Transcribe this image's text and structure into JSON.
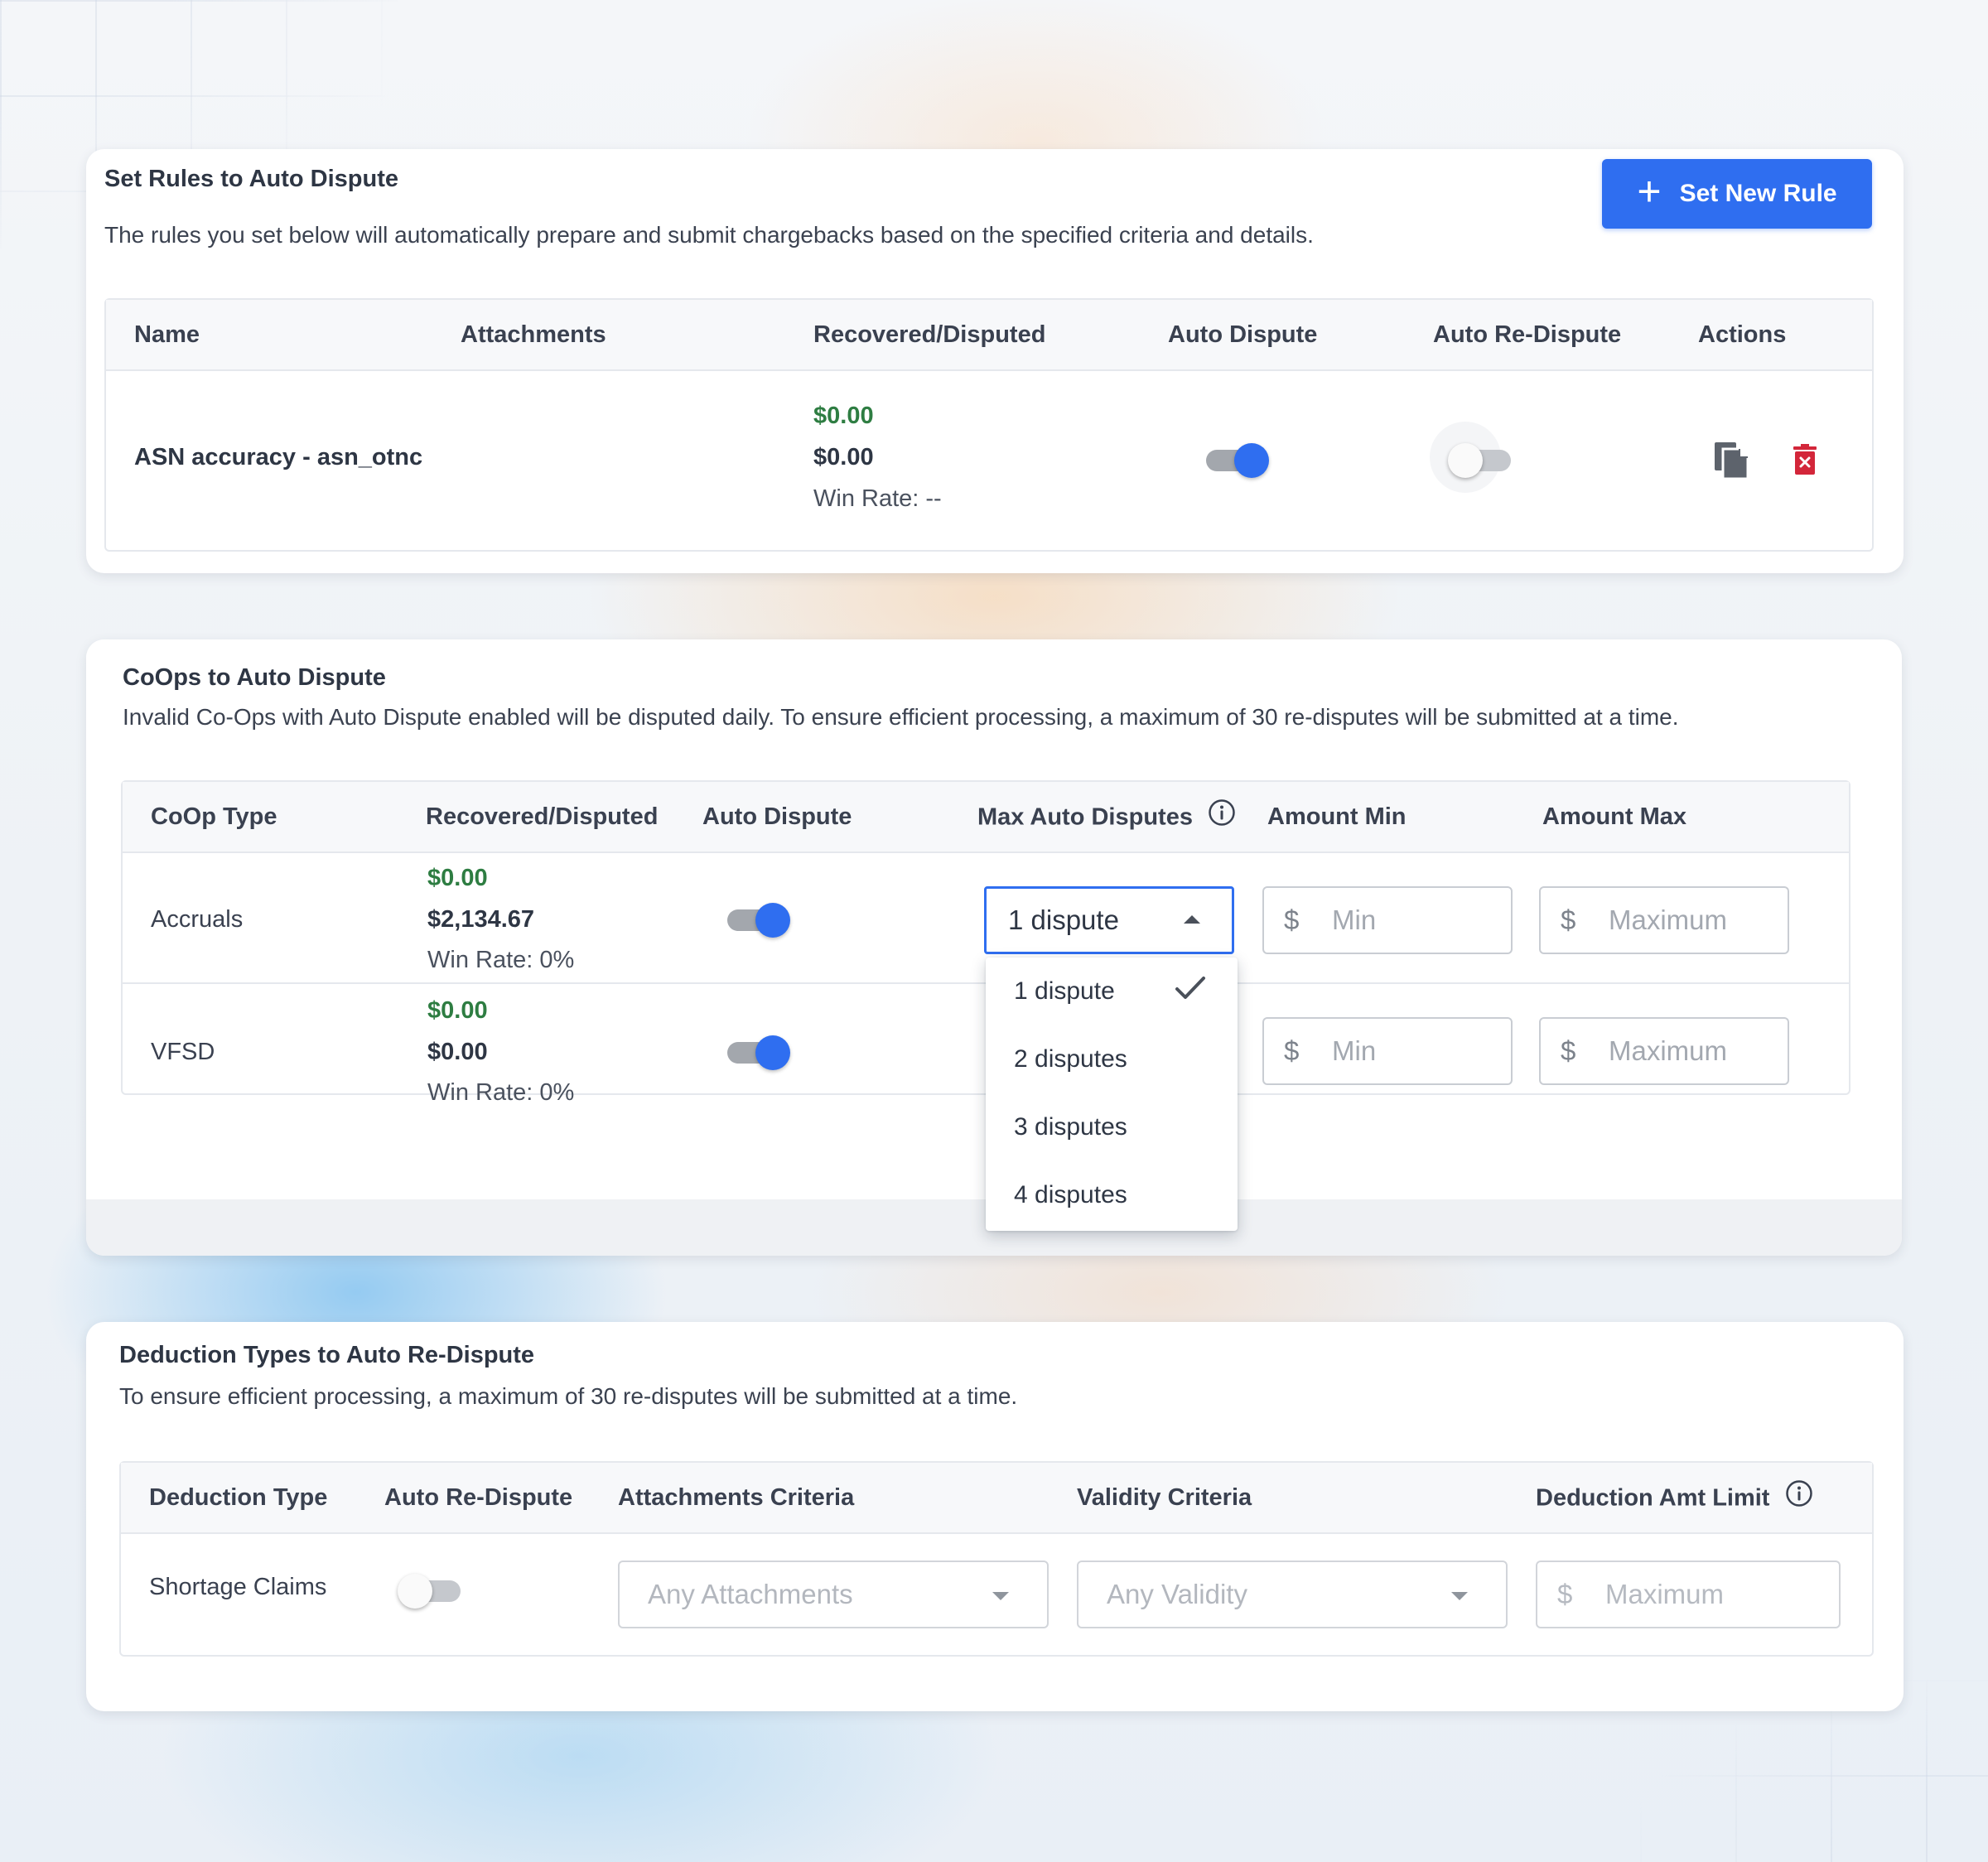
{
  "rules_card": {
    "title": "Set Rules to Auto Dispute",
    "description": "The rules you set below will automatically prepare and submit chargebacks based on the specified criteria and details.",
    "new_rule_button": "Set New Rule",
    "columns": [
      "Name",
      "Attachments",
      "Recovered/Disputed",
      "Auto Dispute",
      "Auto Re-Dispute",
      "Actions"
    ],
    "rows": [
      {
        "name": "ASN accuracy - asn_otnc",
        "attachments": "",
        "recovered": "$0.00",
        "disputed": "$0.00",
        "win_rate": "Win Rate: --",
        "auto_dispute": true,
        "auto_redispute": false,
        "actions": [
          "copy-icon",
          "delete-icon"
        ]
      }
    ]
  },
  "coops_card": {
    "title": "CoOps to Auto Dispute",
    "description": "Invalid Co-Ops with Auto Dispute enabled will be disputed daily. To ensure efficient processing, a maximum of 30 re-disputes will be submitted at a time.",
    "columns": [
      "CoOp Type",
      "Recovered/Disputed",
      "Auto Dispute",
      "Max Auto Disputes",
      "Amount Min",
      "Amount Max"
    ],
    "rows": [
      {
        "type": "Accruals",
        "recovered": "$0.00",
        "disputed": "$2,134.67",
        "win_rate": "Win Rate: 0%",
        "auto_dispute": true,
        "max_auto_disputes": "1 dispute",
        "min_currency": "$",
        "min_placeholder": "Min",
        "max_currency": "$",
        "max_placeholder": "Maximum"
      },
      {
        "type": "VFSD",
        "recovered": "$0.00",
        "disputed": "$0.00",
        "win_rate": "Win Rate: 0%",
        "auto_dispute": true,
        "min_currency": "$",
        "min_placeholder": "Min",
        "max_currency": "$",
        "max_placeholder": "Maximum"
      }
    ],
    "dropdown": {
      "options": [
        "1 dispute",
        "2 disputes",
        "3 disputes",
        "4 disputes"
      ],
      "selected": "1 dispute"
    }
  },
  "deduction_card": {
    "title": "Deduction Types to Auto Re-Dispute",
    "description": "To ensure efficient processing, a maximum of 30 re-disputes will be submitted at a time.",
    "columns": [
      "Deduction Type",
      "Auto Re-Dispute",
      "Attachments Criteria",
      "Validity Criteria",
      "Deduction Amt Limit"
    ],
    "rows": [
      {
        "type": "Shortage Claims",
        "auto_redispute": false,
        "attachments_criteria": "Any Attachments",
        "validity_criteria": "Any Validity",
        "limit_currency": "$",
        "limit_placeholder": "Maximum"
      }
    ]
  },
  "colors": {
    "primary": "#2f6ef0",
    "recovered_green": "#2e7d42",
    "delete_red": "#d3263a"
  }
}
